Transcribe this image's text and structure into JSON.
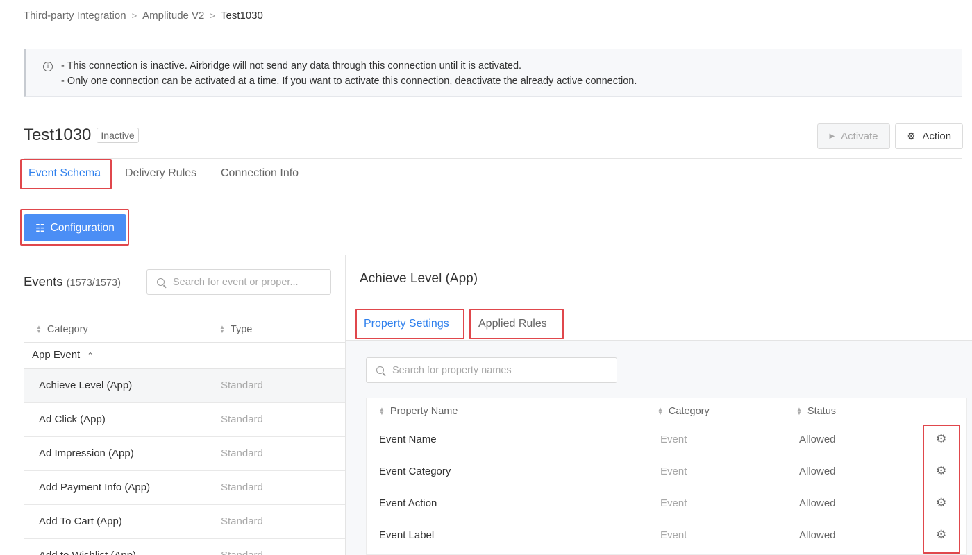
{
  "breadcrumb": {
    "items": [
      "Third-party Integration",
      "Amplitude V2"
    ],
    "current": "Test1030",
    "separator": ">"
  },
  "notice": {
    "icon": "info-icon",
    "lines": [
      "- This connection is inactive. Airbridge will not send any data through this connection until it is activated.",
      "- Only one connection can be activated at a time. If you want to activate this connection, deactivate the already active connection."
    ]
  },
  "header": {
    "title": "Test1030",
    "status_badge": "Inactive",
    "activate_label": "Activate",
    "action_label": "Action"
  },
  "tabs": [
    "Event Schema",
    "Delivery Rules",
    "Connection Info"
  ],
  "active_tab": "Event Schema",
  "configuration_label": "Configuration",
  "events": {
    "title": "Events",
    "count": "(1573/1573)",
    "search_placeholder": "Search for event or proper...",
    "columns": [
      "Category",
      "Type"
    ],
    "group": "App Event",
    "rows": [
      {
        "name": "Achieve Level (App)",
        "type": "Standard"
      },
      {
        "name": "Ad Click (App)",
        "type": "Standard"
      },
      {
        "name": "Ad Impression (App)",
        "type": "Standard"
      },
      {
        "name": "Add Payment Info (App)",
        "type": "Standard"
      },
      {
        "name": "Add To Cart (App)",
        "type": "Standard"
      },
      {
        "name": "Add to Wishlist (App)",
        "type": "Standard"
      }
    ],
    "selected": "Achieve Level (App)"
  },
  "detail": {
    "title": "Achieve Level (App)",
    "subtabs": [
      "Property Settings",
      "Applied Rules"
    ],
    "active_subtab": "Property Settings",
    "search_placeholder": "Search for property names",
    "columns": [
      "Property Name",
      "Category",
      "Status"
    ],
    "rows": [
      {
        "name": "Event Name",
        "category": "Event",
        "status": "Allowed"
      },
      {
        "name": "Event Category",
        "category": "Event",
        "status": "Allowed"
      },
      {
        "name": "Event Action",
        "category": "Event",
        "status": "Allowed"
      },
      {
        "name": "Event Label",
        "category": "Event",
        "status": "Allowed"
      }
    ]
  },
  "colors": {
    "accent": "#2f80ed",
    "button_primary": "#4b8ef5",
    "highlight": "#e0474c"
  }
}
